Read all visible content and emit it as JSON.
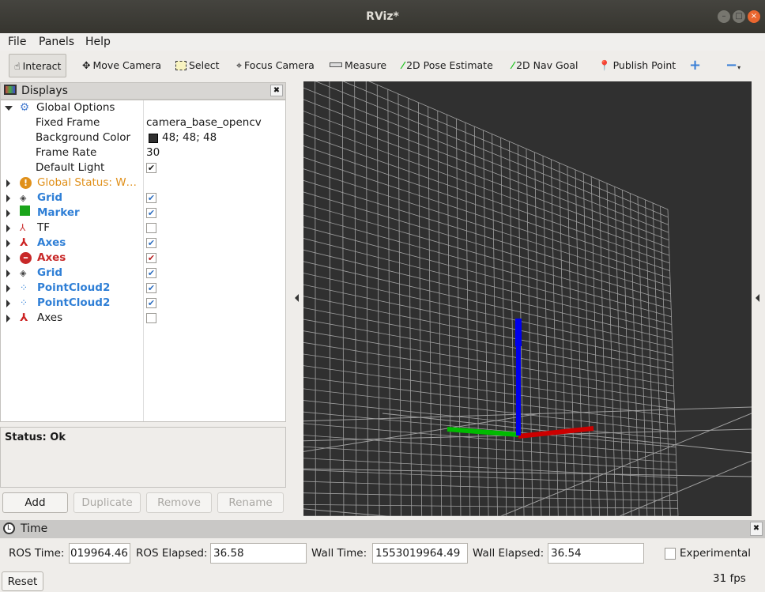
{
  "window": {
    "title": "RViz*"
  },
  "menu": [
    "File",
    "Panels",
    "Help"
  ],
  "toolbar": {
    "tools": [
      "Interact",
      "Move Camera",
      "Select",
      "Focus Camera",
      "Measure",
      "2D Pose Estimate",
      "2D Nav Goal",
      "Publish Point"
    ],
    "active": "Interact"
  },
  "displays": {
    "title": "Displays",
    "global_options": {
      "label": "Global Options",
      "props": [
        {
          "name": "Fixed Frame",
          "value": "camera_base_opencv"
        },
        {
          "name": "Background Color",
          "value": "48; 48; 48",
          "swatch": "#303030"
        },
        {
          "name": "Frame Rate",
          "value": "30"
        },
        {
          "name": "Default Light",
          "checked": true
        }
      ]
    },
    "global_status": "Global Status: W…",
    "items": [
      {
        "label": "Grid",
        "icon": "grid-icon",
        "checked": true,
        "style": "blue"
      },
      {
        "label": "Marker",
        "icon": "cube-icon",
        "checked": true,
        "style": "blue"
      },
      {
        "label": "TF",
        "icon": "tf-icon",
        "checked": false,
        "style": "normal"
      },
      {
        "label": "Axes",
        "icon": "axes-icon",
        "checked": true,
        "style": "blue"
      },
      {
        "label": "Axes",
        "icon": "error-icon",
        "checked": true,
        "style": "red"
      },
      {
        "label": "Grid",
        "icon": "grid-icon",
        "checked": true,
        "style": "blue"
      },
      {
        "label": "PointCloud2",
        "icon": "pointcloud-icon",
        "checked": true,
        "style": "blue"
      },
      {
        "label": "PointCloud2",
        "icon": "pointcloud-icon",
        "checked": true,
        "style": "blue"
      },
      {
        "label": "Axes",
        "icon": "axes-icon",
        "checked": false,
        "style": "normal"
      }
    ],
    "status": "Status: Ok",
    "buttons": {
      "add": "Add",
      "duplicate": "Duplicate",
      "remove": "Remove",
      "rename": "Rename"
    }
  },
  "time": {
    "title": "Time",
    "ros_time_label": "ROS Time:",
    "ros_time": "019964.46",
    "ros_elapsed_label": "ROS Elapsed:",
    "ros_elapsed": "36.58",
    "wall_time_label": "Wall Time:",
    "wall_time": "1553019964.49",
    "wall_elapsed_label": "Wall Elapsed:",
    "wall_elapsed": "36.54",
    "experimental": "Experimental",
    "experimental_checked": false,
    "reset": "Reset",
    "fps": "31 fps"
  },
  "colors": {
    "background": "#303030",
    "grid": "#a0a0a0",
    "x_axis": "#cc0000",
    "y_axis": "#00bb00",
    "z_axis": "#0000ee",
    "warning": "#e0901a",
    "error": "#c82828",
    "link_blue": "#2f7fd6"
  }
}
